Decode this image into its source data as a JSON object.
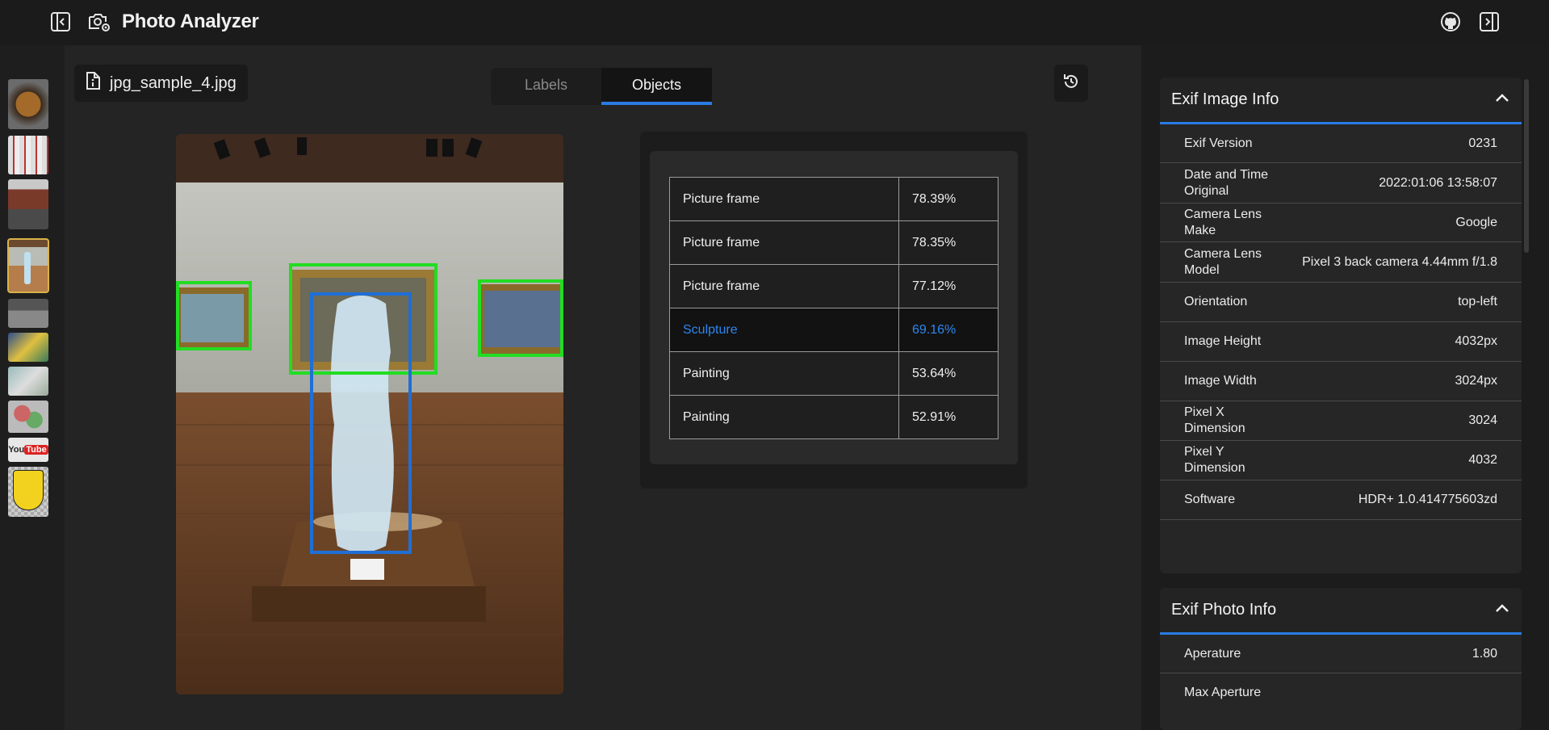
{
  "app": {
    "title": "Photo Analyzer"
  },
  "header_icons": [
    "sidebar-collapse-left-icon",
    "camera-settings-icon",
    "github-icon",
    "sidebar-collapse-right-icon"
  ],
  "file": {
    "name": "jpg_sample_4.jpg"
  },
  "tabs": [
    {
      "label": "Labels",
      "active": false
    },
    {
      "label": "Objects",
      "active": true
    }
  ],
  "objects": [
    {
      "label": "Picture frame",
      "score": "78.39%"
    },
    {
      "label": "Picture frame",
      "score": "78.35%"
    },
    {
      "label": "Picture frame",
      "score": "77.12%"
    },
    {
      "label": "Sculpture",
      "score": "69.16%",
      "highlighted": true
    },
    {
      "label": "Painting",
      "score": "53.64%"
    },
    {
      "label": "Painting",
      "score": "52.91%"
    }
  ],
  "exif_image": {
    "title": "Exif Image Info",
    "rows": [
      {
        "k": "Exif Version",
        "v": "0231"
      },
      {
        "k": "Date and Time Original",
        "v": "2022:01:06 13:58:07"
      },
      {
        "k": "Camera Lens Make",
        "v": "Google"
      },
      {
        "k": "Camera Lens Model",
        "v": "Pixel 3 back camera 4.44mm f/1.8"
      },
      {
        "k": "Orientation",
        "v": "top-left"
      },
      {
        "k": "Image Height",
        "v": "4032px"
      },
      {
        "k": "Image Width",
        "v": "3024px"
      },
      {
        "k": "Pixel X Dimension",
        "v": "3024"
      },
      {
        "k": "Pixel Y Dimension",
        "v": "4032"
      },
      {
        "k": "Software",
        "v": "HDR+ 1.0.414775603zd"
      }
    ]
  },
  "exif_photo": {
    "title": "Exif Photo Info",
    "rows": [
      {
        "k": "Aperature",
        "v": "1.80"
      },
      {
        "k": "Max Aperture",
        "v": ""
      }
    ]
  },
  "colors": {
    "accent": "#2a7be4",
    "detection_frame": "#22dd22",
    "detection_selected": "#1f6fd6",
    "thumb_active": "#d9b24a"
  }
}
